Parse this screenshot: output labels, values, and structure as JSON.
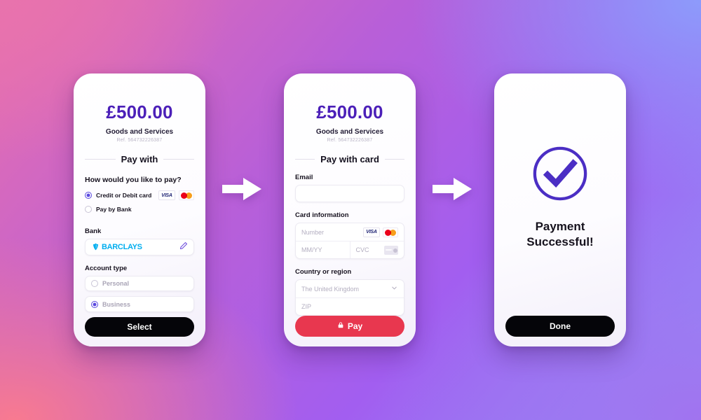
{
  "background": {
    "gradient_colors": [
      "#e873ad",
      "#f87a90",
      "#a25ef0",
      "#8d9bfb"
    ]
  },
  "colors": {
    "amount_purple": "#4b1fb8",
    "accent_purple": "#5b4ae0",
    "pay_button_red": "#e8374f",
    "dark_button": "#050509",
    "barclays_cyan": "#00aeef",
    "visa_navy": "#1a1f71",
    "mastercard_red": "#eb001b",
    "mastercard_orange": "#f79e1b"
  },
  "screens": [
    {
      "id": "pay-with",
      "amount": "£500.00",
      "merchant": "Goods and Services",
      "reference": "Ref. 564732226387",
      "section_title": "Pay with",
      "question_label": "How would you like to pay?",
      "payment_options": [
        {
          "label": "Credit or Debit card",
          "selected": true,
          "brands": [
            "visa-icon",
            "mastercard-icon"
          ]
        },
        {
          "label": "Pay by Bank",
          "selected": false,
          "brands": []
        }
      ],
      "bank_label": "Bank",
      "bank_name": "BARCLAYS",
      "bank_edit_icon": "pencil-icon",
      "account_type_label": "Account type",
      "account_types": [
        {
          "label": "Personal",
          "selected": false
        },
        {
          "label": "Business",
          "selected": true
        }
      ],
      "primary_button": "Select"
    },
    {
      "id": "pay-with-card",
      "amount": "£500.00",
      "merchant": "Goods and Services",
      "reference": "Ref. 564732226387",
      "section_title": "Pay with card",
      "email_label": "Email",
      "email_value": "",
      "card_info_label": "Card information",
      "card_number_placeholder": "Number",
      "card_brands": [
        "visa-icon",
        "mastercard-icon"
      ],
      "expiry_placeholder": "MM/YY",
      "cvc_placeholder": "CVC",
      "cvc_icon": "card-back-icon",
      "country_label": "Country or region",
      "country_value": "The United Kingdom",
      "country_chevron": "chevron-down-icon",
      "zip_placeholder": "ZIP",
      "pay_button": "Pay",
      "pay_button_icon": "lock-icon"
    },
    {
      "id": "payment-success",
      "success_icon": "check-circle-icon",
      "title_line_1": "Payment",
      "title_line_2": "Successful!",
      "primary_button": "Done"
    }
  ],
  "arrows": [
    {
      "name": "arrow-right-icon-1"
    },
    {
      "name": "arrow-right-icon-2"
    }
  ]
}
